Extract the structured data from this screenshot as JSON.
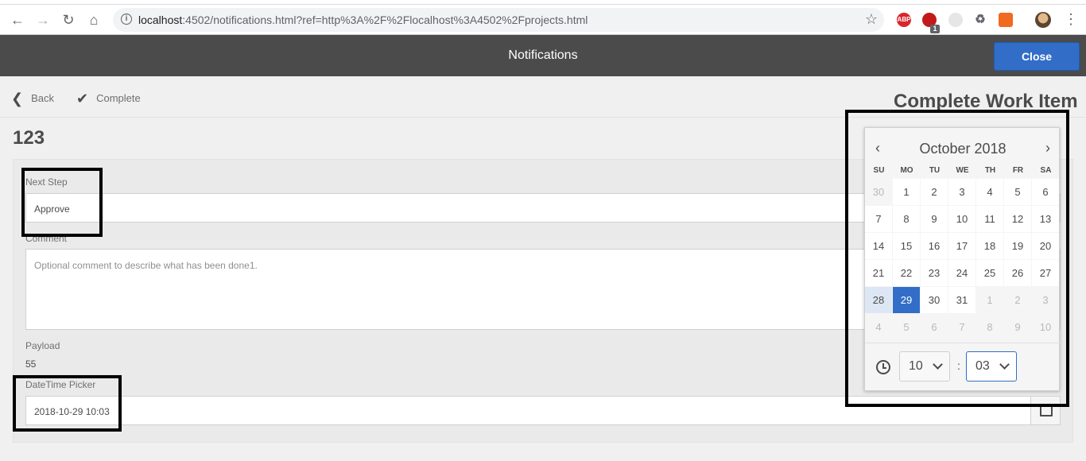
{
  "browser": {
    "url_host": "localhost",
    "url_rest": ":4502/notifications.html?ref=http%3A%2F%2Flocalhost%3A4502%2Fprojects.html",
    "badge_count": "1"
  },
  "header": {
    "title": "Notifications",
    "close_label": "Close"
  },
  "actions": {
    "back_label": "Back",
    "complete_label": "Complete"
  },
  "page_heading": "Complete Work Item",
  "item_title": "123",
  "form": {
    "next_step_label": "Next Step",
    "next_step_value": "Approve",
    "comment_label": "Comment",
    "comment_placeholder": "Optional comment to describe what has been done1.",
    "payload_label": "Payload",
    "payload_value": "55",
    "datetime_label": "DateTime Picker",
    "datetime_value": "2018-10-29 10:03"
  },
  "calendar": {
    "month_label": "October 2018",
    "days_of_week": [
      "SU",
      "MO",
      "TU",
      "WE",
      "TH",
      "FR",
      "SA"
    ],
    "weeks": [
      [
        "30",
        "1",
        "2",
        "3",
        "4",
        "5",
        "6"
      ],
      [
        "7",
        "8",
        "9",
        "10",
        "11",
        "12",
        "13"
      ],
      [
        "14",
        "15",
        "16",
        "17",
        "18",
        "19",
        "20"
      ],
      [
        "21",
        "22",
        "23",
        "24",
        "25",
        "26",
        "27"
      ],
      [
        "28",
        "29",
        "30",
        "31",
        "1",
        "2",
        "3"
      ],
      [
        "4",
        "5",
        "6",
        "7",
        "8",
        "9",
        "10"
      ]
    ],
    "today": "28",
    "selected": "29",
    "hour": "10",
    "minute": "03",
    "time_separator": ":"
  },
  "colors": {
    "accent": "#326ec8",
    "header_bg": "#4b4b4b",
    "highlight_box": "#000000"
  }
}
